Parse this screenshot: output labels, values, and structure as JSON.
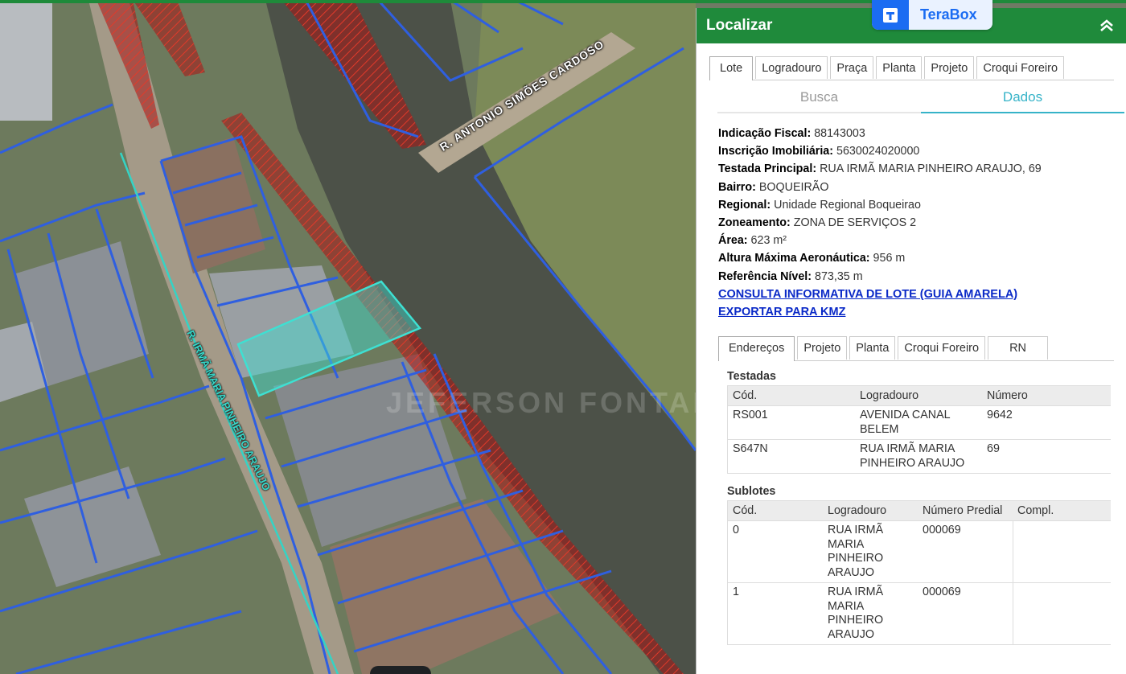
{
  "map": {
    "street_labels": {
      "simoes": "R. ANTONIO SIMÕES CARDOSO",
      "pinheiro": "R. IRMÃ MARIA PINHEIRO ARAUJO"
    },
    "watermark": "JEFERSON FONTANA",
    "colors": {
      "lot_lines": "#2f5fe0",
      "selected_lot": "#3ee0d2",
      "hatch": "#c0271e",
      "street_axis": "#35d3c5"
    }
  },
  "terabox": {
    "label": "TeraBox"
  },
  "panel": {
    "title": "Localizar",
    "tabs": [
      "Lote",
      "Logradouro",
      "Praça",
      "Planta",
      "Projeto",
      "Croqui Foreiro"
    ],
    "active_tab": 0,
    "subtabs": [
      "Busca",
      "Dados"
    ],
    "active_subtab": 1,
    "fields": [
      {
        "label": "Indicação Fiscal:",
        "value": "88143003"
      },
      {
        "label": "Inscrição Imobiliária:",
        "value": "5630024020000"
      },
      {
        "label": "Testada Principal:",
        "value": "RUA IRMÃ MARIA PINHEIRO ARAUJO, 69"
      },
      {
        "label": "Bairro:",
        "value": "BOQUEIRÃO"
      },
      {
        "label": "Regional:",
        "value": "Unidade Regional Boqueirao"
      },
      {
        "label": "Zoneamento:",
        "value": "ZONA DE SERVIÇOS 2"
      },
      {
        "label": "Área:",
        "value": "623 m²"
      },
      {
        "label": "Altura Máxima Aeronáutica:",
        "value": "956 m"
      },
      {
        "label": "Referência Nível:",
        "value": "873,35 m"
      }
    ],
    "links": {
      "guia_amarela": "CONSULTA INFORMATIVA DE LOTE (GUIA AMARELA)",
      "kmz": "EXPORTAR PARA KMZ"
    },
    "inner_tabs": [
      "Endereços",
      "Projeto",
      "Planta",
      "Croqui Foreiro",
      "RN"
    ],
    "active_inner_tab": 0,
    "testadas": {
      "title": "Testadas",
      "headers": [
        "Cód.",
        "Logradouro",
        "Número"
      ],
      "rows": [
        [
          "RS001",
          "AVENIDA CANAL BELEM",
          "9642"
        ],
        [
          "S647N",
          "RUA IRMÃ MARIA PINHEIRO ARAUJO",
          "69"
        ]
      ]
    },
    "sublotes": {
      "title": "Sublotes",
      "headers": [
        "Cód.",
        "Logradouro",
        "Número Predial",
        "Compl."
      ],
      "rows": [
        [
          "0",
          "RUA IRMÃ MARIA PINHEIRO ARAUJO",
          "000069",
          ""
        ],
        [
          "1",
          "RUA IRMÃ MARIA PINHEIRO ARAUJO",
          "000069",
          ""
        ]
      ]
    }
  }
}
